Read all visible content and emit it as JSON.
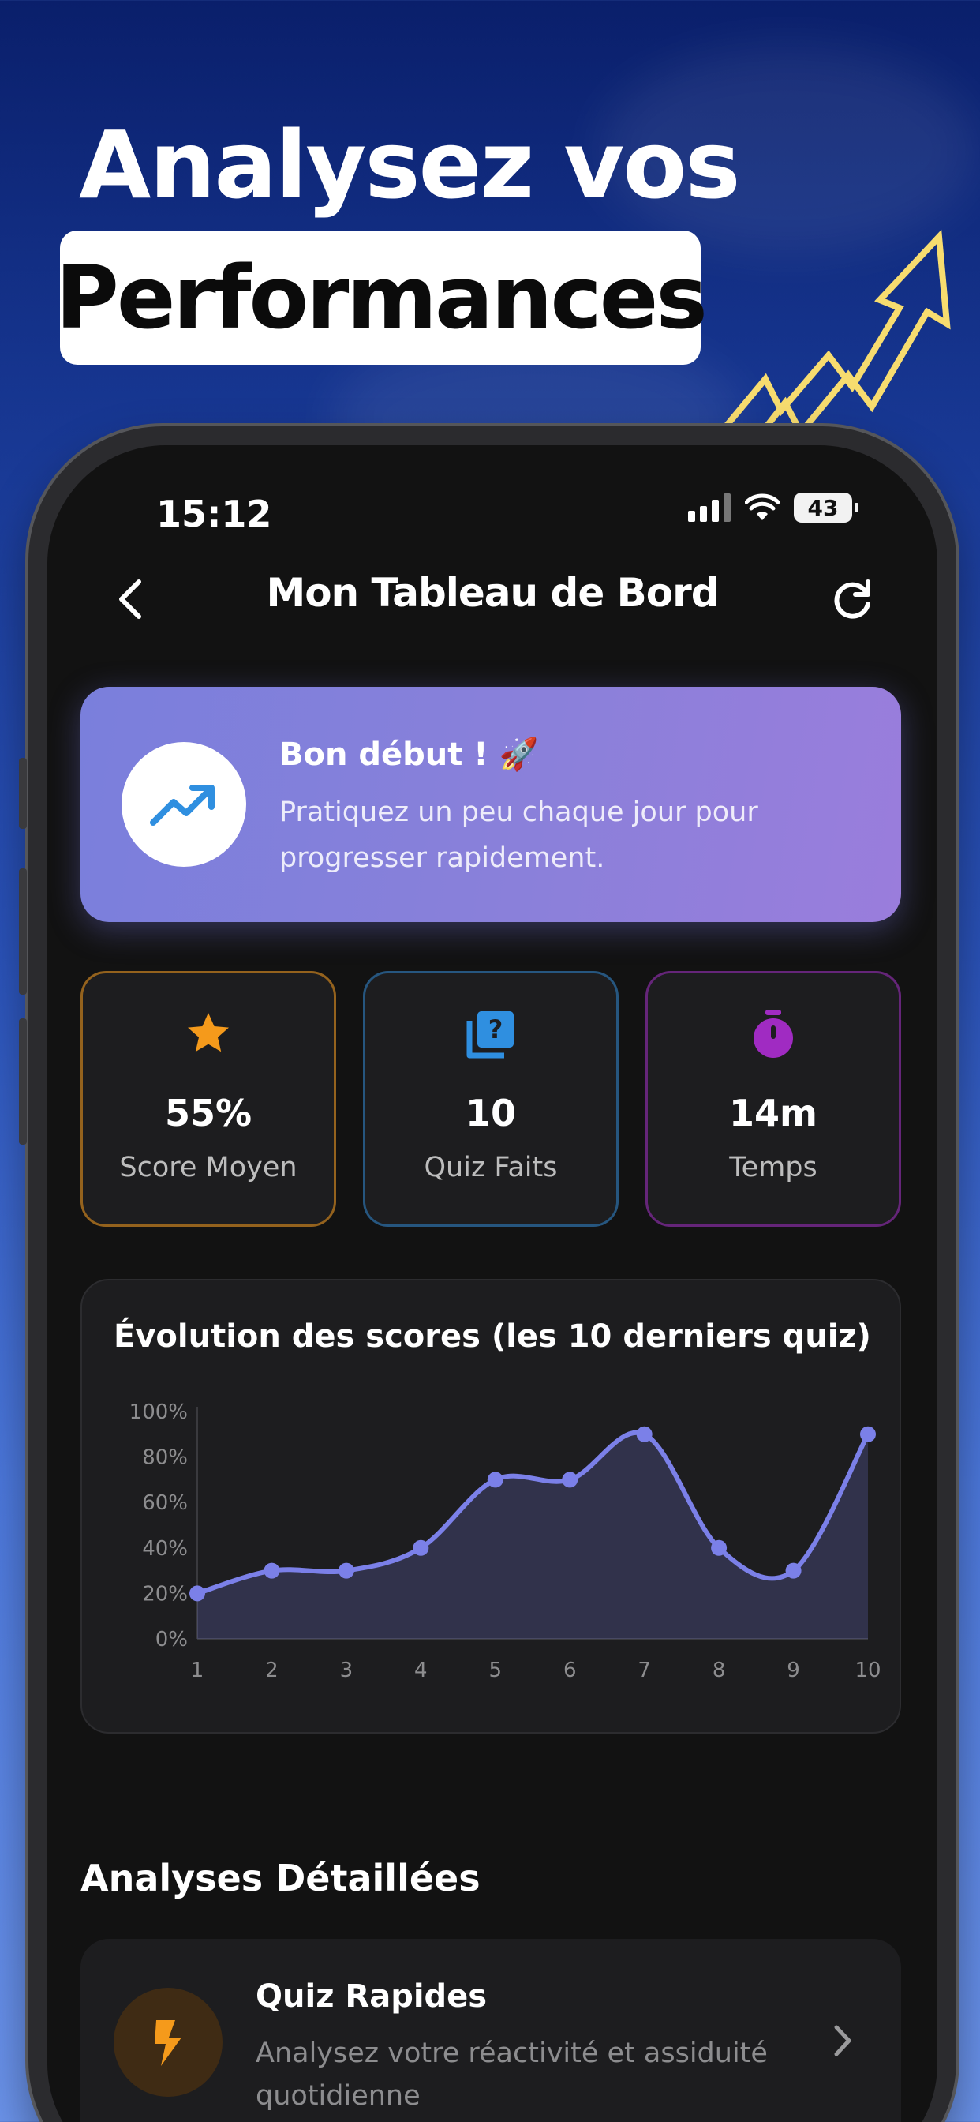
{
  "promo": {
    "line1": "Analysez vos",
    "line2": "Performances"
  },
  "status_bar": {
    "time": "15:12",
    "battery": "43"
  },
  "nav": {
    "title": "Mon Tableau de Bord",
    "back_icon": "chevron-left-icon",
    "refresh_icon": "refresh-icon"
  },
  "banner": {
    "title": "Bon début ! 🚀",
    "text": "Pratiquez un peu chaque jour pour progresser rapidement.",
    "icon": "trending-up-icon"
  },
  "stats": [
    {
      "value": "55%",
      "label": "Score Moyen",
      "icon": "star-icon",
      "color": "#f59a1b"
    },
    {
      "value": "10",
      "label": "Quiz Faits",
      "icon": "quiz-icon",
      "color": "#2f8fe0"
    },
    {
      "value": "14m",
      "label": "Temps",
      "icon": "stopwatch-icon",
      "color": "#a02bc2"
    }
  ],
  "chart_data": {
    "type": "area",
    "title": "Évolution des scores (les 10 derniers quiz)",
    "x": [
      "1",
      "2",
      "3",
      "4",
      "5",
      "6",
      "7",
      "8",
      "9",
      "10"
    ],
    "values": [
      20,
      30,
      30,
      40,
      70,
      70,
      90,
      40,
      30,
      90
    ],
    "yticks": [
      "0%",
      "20%",
      "40%",
      "60%",
      "80%",
      "100%"
    ],
    "ylim": [
      0,
      100
    ],
    "color": "#7b80e8",
    "grid": false
  },
  "analyses": {
    "section_title": "Analyses Détaillées",
    "items": [
      {
        "title": "Quiz Rapides",
        "subtitle": "Analysez votre réactivité et assiduité quotidienne",
        "icon": "lightning-icon",
        "color": "#f59a1b"
      }
    ]
  }
}
